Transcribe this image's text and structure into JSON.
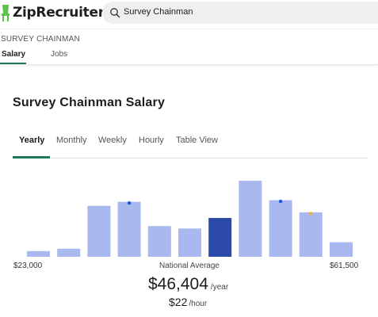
{
  "header": {
    "logo_text": "ZipRecruiter",
    "search_value": "Survey Chainman"
  },
  "subnav": {
    "job_caption": "SURVEY CHAINMAN",
    "tabs": [
      {
        "label": "Salary",
        "active": true
      },
      {
        "label": "Jobs",
        "active": false
      }
    ]
  },
  "main": {
    "heading": "Survey Chainman Salary",
    "period_tabs": [
      {
        "label": "Yearly",
        "active": true
      },
      {
        "label": "Monthly",
        "active": false
      },
      {
        "label": "Weekly",
        "active": false
      },
      {
        "label": "Hourly",
        "active": false
      },
      {
        "label": "Table View",
        "active": false
      }
    ],
    "range_min": "$23,000",
    "range_max": "$61,500",
    "average_label": "National Average",
    "yearly_salary": "$46,404",
    "yearly_unit": "/year",
    "hourly_salary": "$22",
    "hourly_unit": "/hour"
  },
  "chart_data": {
    "type": "bar",
    "values": [
      7,
      10,
      63,
      68,
      38,
      35,
      48,
      94,
      70,
      55,
      18
    ],
    "highlight_index": 6,
    "dots": [
      {
        "bar": 3,
        "color": "#1b56e0"
      },
      {
        "bar": 8,
        "color": "#1b56e0"
      },
      {
        "bar": 9,
        "color": "#f2b33d"
      }
    ],
    "ylim": [
      0,
      100
    ],
    "colors": {
      "bar": "#a9b8ee",
      "highlight": "#2b49a8"
    }
  }
}
